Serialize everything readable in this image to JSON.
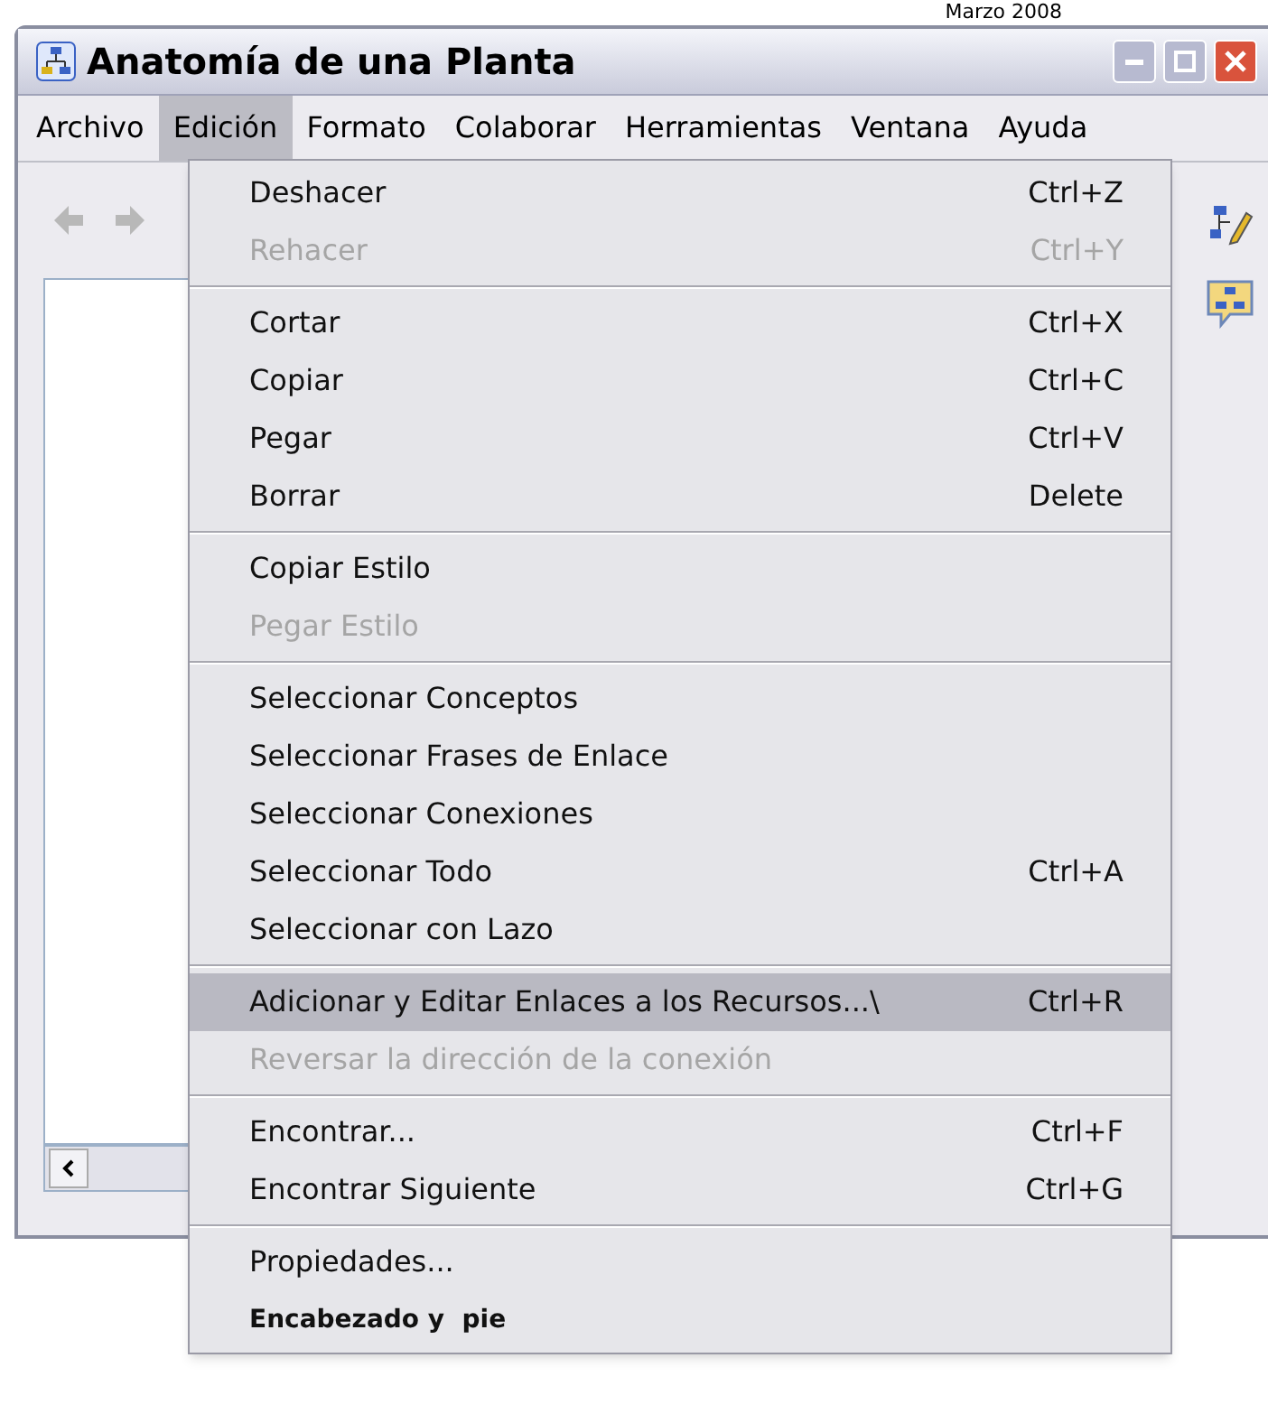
{
  "caption": "Marzo 2008",
  "window": {
    "title": "Anatomía de una Planta"
  },
  "menubar": [
    {
      "label": "Archivo",
      "selected": false
    },
    {
      "label": "Edición",
      "selected": true
    },
    {
      "label": "Formato",
      "selected": false
    },
    {
      "label": "Colaborar",
      "selected": false
    },
    {
      "label": "Herramientas",
      "selected": false
    },
    {
      "label": "Ventana",
      "selected": false
    },
    {
      "label": "Ayuda",
      "selected": false
    }
  ],
  "menu": [
    {
      "kind": "item",
      "label": "Deshacer",
      "shortcut": "Ctrl+Z",
      "disabled": false,
      "selected": false,
      "bold": false
    },
    {
      "kind": "item",
      "label": "Rehacer",
      "shortcut": "Ctrl+Y",
      "disabled": true,
      "selected": false,
      "bold": false
    },
    {
      "kind": "separator"
    },
    {
      "kind": "item",
      "label": "Cortar",
      "shortcut": "Ctrl+X",
      "disabled": false,
      "selected": false,
      "bold": false
    },
    {
      "kind": "item",
      "label": "Copiar",
      "shortcut": "Ctrl+C",
      "disabled": false,
      "selected": false,
      "bold": false
    },
    {
      "kind": "item",
      "label": "Pegar",
      "shortcut": "Ctrl+V",
      "disabled": false,
      "selected": false,
      "bold": false
    },
    {
      "kind": "item",
      "label": "Borrar",
      "shortcut": "Delete",
      "disabled": false,
      "selected": false,
      "bold": false
    },
    {
      "kind": "separator"
    },
    {
      "kind": "item",
      "label": "Copiar Estilo",
      "disabled": false,
      "selected": false,
      "bold": false
    },
    {
      "kind": "item",
      "label": "Pegar Estilo",
      "disabled": true,
      "selected": false,
      "bold": false
    },
    {
      "kind": "separator"
    },
    {
      "kind": "item",
      "label": "Seleccionar Conceptos",
      "disabled": false,
      "selected": false,
      "bold": false
    },
    {
      "kind": "item",
      "label": "Seleccionar Frases de Enlace",
      "disabled": false,
      "selected": false,
      "bold": false
    },
    {
      "kind": "item",
      "label": "Seleccionar Conexiones",
      "disabled": false,
      "selected": false,
      "bold": false
    },
    {
      "kind": "item",
      "label": "Seleccionar Todo",
      "shortcut": "Ctrl+A",
      "disabled": false,
      "selected": false,
      "bold": false
    },
    {
      "kind": "item",
      "label": "Seleccionar con Lazo",
      "disabled": false,
      "selected": false,
      "bold": false
    },
    {
      "kind": "separator"
    },
    {
      "kind": "item",
      "label": "Adicionar y Editar Enlaces a los Recursos...\\",
      "shortcut": "Ctrl+R",
      "disabled": false,
      "selected": true,
      "bold": false
    },
    {
      "kind": "item",
      "label": "Reversar la dirección de la conexión",
      "disabled": true,
      "selected": false,
      "bold": false
    },
    {
      "kind": "separator"
    },
    {
      "kind": "item",
      "label": "Encontrar...",
      "shortcut": "Ctrl+F",
      "disabled": false,
      "selected": false,
      "bold": false
    },
    {
      "kind": "item",
      "label": "Encontrar Siguiente",
      "shortcut": "Ctrl+G",
      "disabled": false,
      "selected": false,
      "bold": false
    },
    {
      "kind": "separator"
    },
    {
      "kind": "item",
      "label": "Propiedades...",
      "disabled": false,
      "selected": false,
      "bold": false
    },
    {
      "kind": "item",
      "label": "Encabezado y  pie",
      "disabled": false,
      "selected": false,
      "bold": true
    }
  ]
}
